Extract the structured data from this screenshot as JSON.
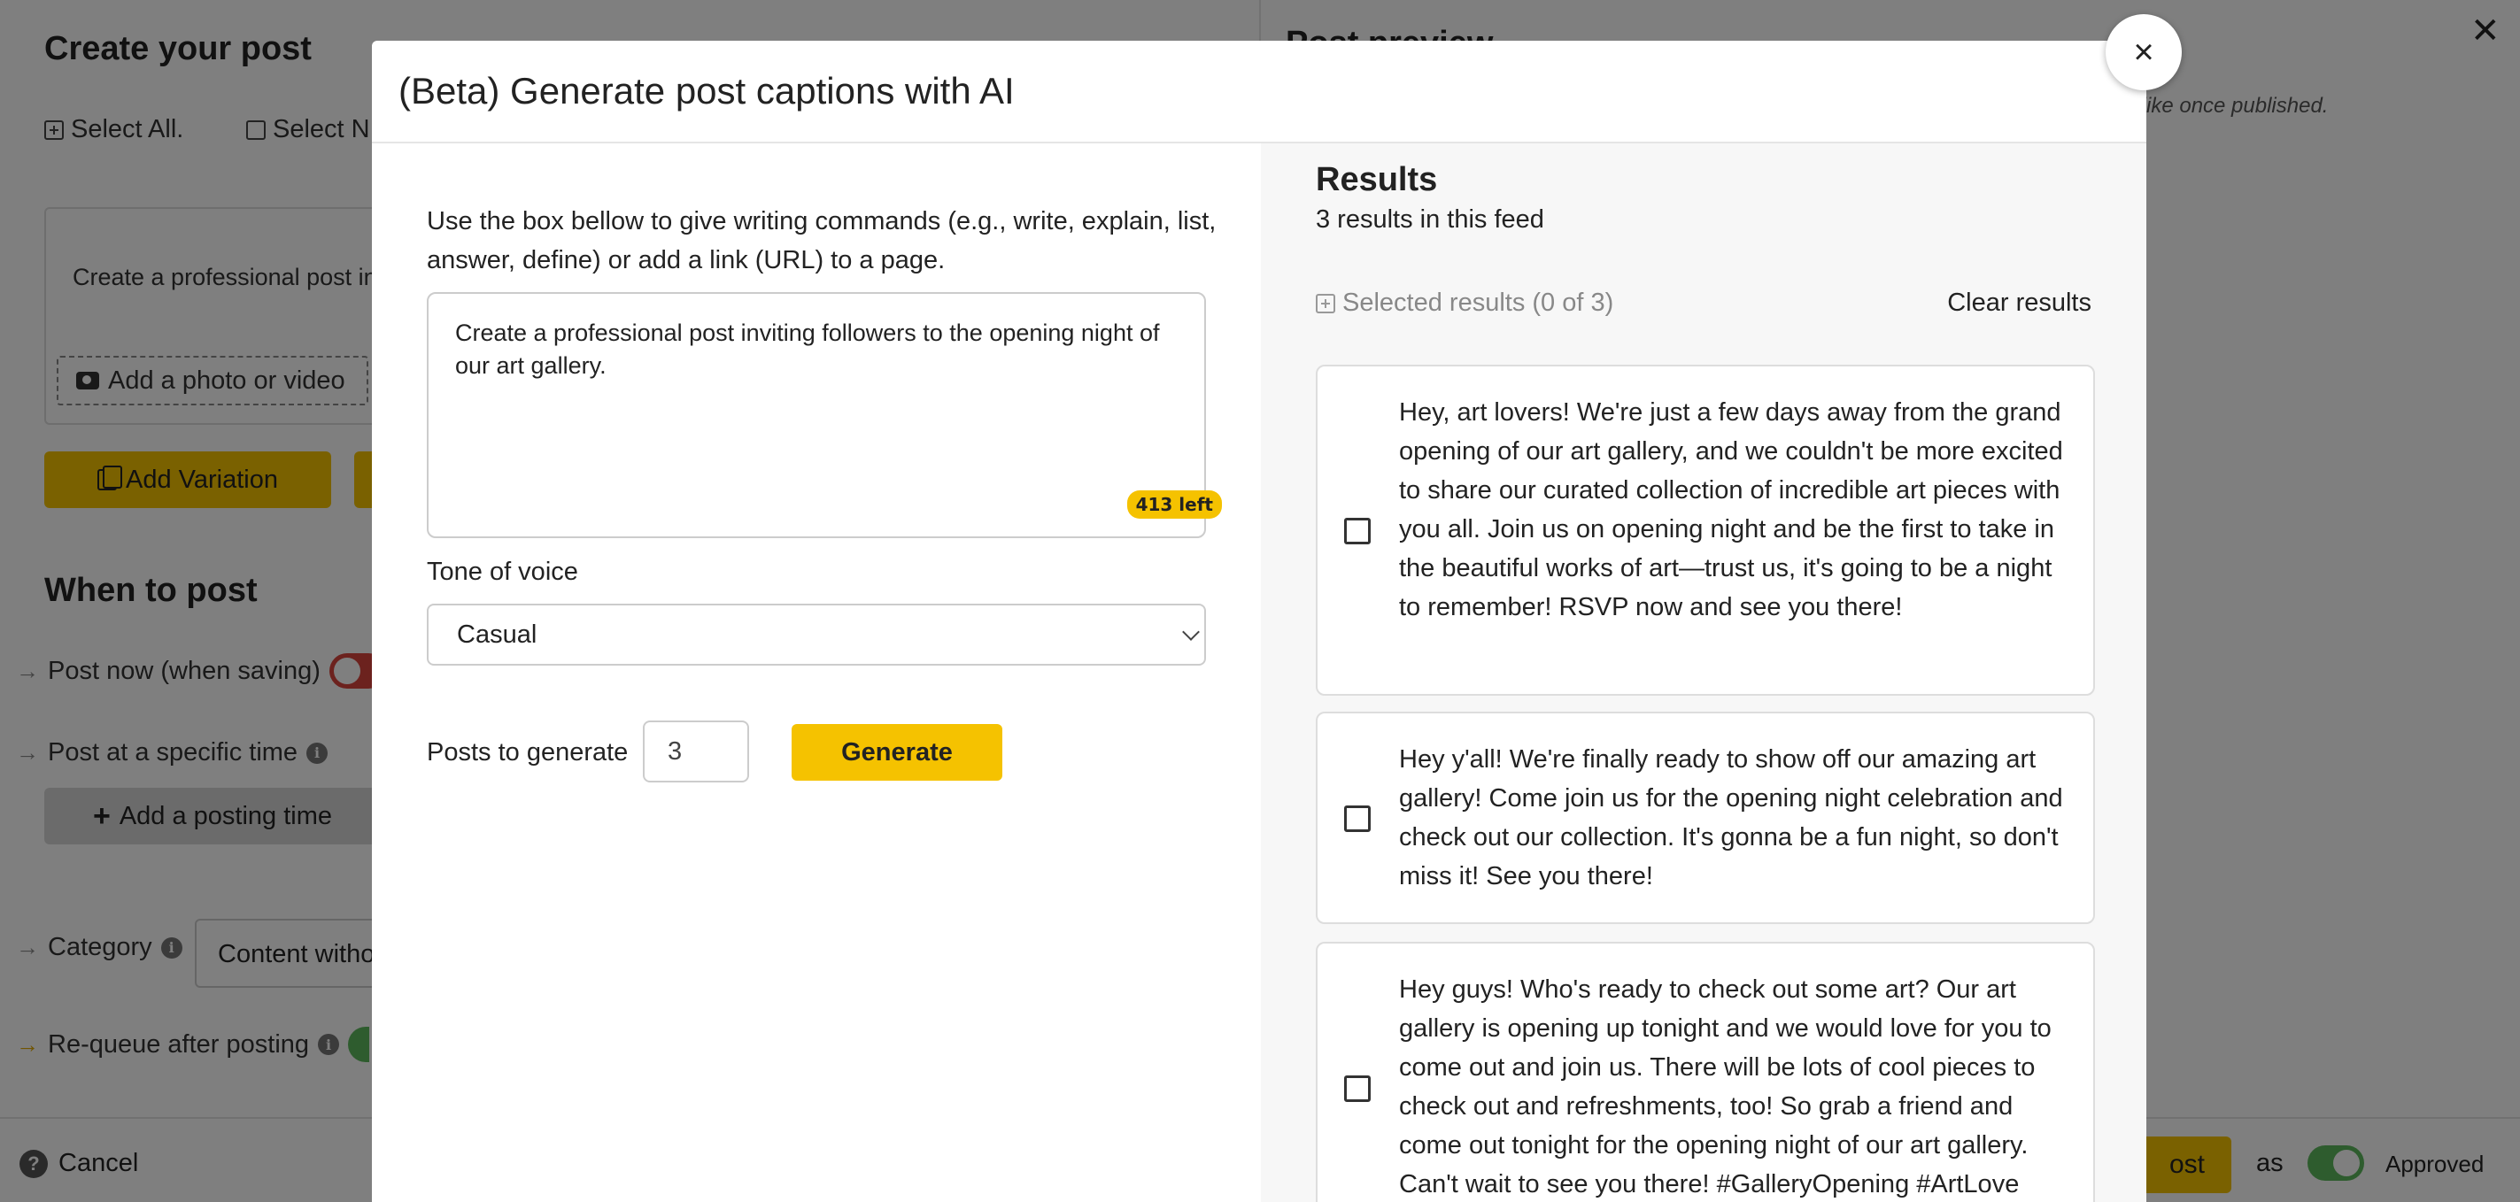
{
  "background": {
    "title": "Create your post",
    "select_all": "Select All.",
    "select_none": "Select N",
    "editor_text": "Create a professional post in",
    "add_photo": "Add a photo or video",
    "add_variation": "Add Variation",
    "when_to_post": "When to post",
    "post_now": "Post now (when saving)",
    "post_specific": "Post at a specific time",
    "add_posting_time": "Add a posting time",
    "category_label": "Category",
    "category_value": "Content witho",
    "requeue": "Re-queue after posting",
    "right_title": "Post preview",
    "right_sub": "k like once published.",
    "cancel": "Cancel",
    "post_button": "ost",
    "as": "as",
    "approved": "Approved"
  },
  "modal": {
    "title": "(Beta) Generate post captions with AI",
    "instructions": "Use the box bellow to give writing commands (e.g., write, explain, list, answer, define) or add a link (URL) to a page.",
    "prompt": "Create a professional post inviting followers to the opening night of our art gallery.",
    "chars_left": "413 left",
    "tone_label": "Tone of voice",
    "tone_value": "Casual",
    "posts_label": "Posts to generate",
    "posts_value": "3",
    "generate": "Generate",
    "close": "×"
  },
  "results": {
    "title": "Results",
    "count": "3 results in this feed",
    "selected": "Selected results (0 of 3)",
    "clear": "Clear results",
    "items": [
      {
        "text": "Hey, art lovers! We're just a few days away from the grand opening of our art gallery, and we couldn't be more excited to share our curated collection of incredible art pieces with you all. Join us on opening night and be the first to take in the beautiful works of art—trust us, it's going to be a night to remember! RSVP now and see you there!"
      },
      {
        "text": "Hey y'all! We're finally ready to show off our amazing art gallery! Come join us for the opening night celebration and check out our collection. It's gonna be a fun night, so don't miss it! See you there!"
      },
      {
        "text": "Hey guys! Who's ready to check out some art? Our art gallery is opening up tonight and we would love for you to come out and join us. There will be lots of cool pieces to check out and refreshments, too! So grab a friend and come out tonight for the opening night of our art gallery. Can't wait to see you there! #GalleryOpening #ArtLove"
      }
    ]
  },
  "colors": {
    "accent": "#f5c200",
    "toggle_off": "#d8453d",
    "toggle_on": "#5cb85c"
  },
  "icons": [
    "plus-square-icon",
    "square-icon",
    "camera-icon",
    "copy-icon",
    "arrow-right-icon",
    "info-icon",
    "plus-icon",
    "question-icon",
    "close-icon",
    "chevron-down-icon",
    "checkbox-icon"
  ]
}
